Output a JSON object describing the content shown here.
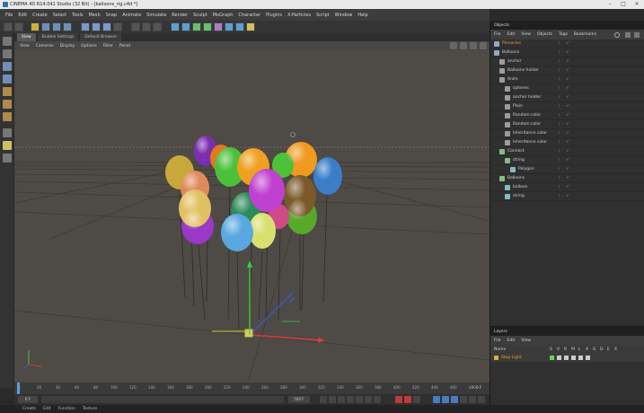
{
  "window": {
    "title": "CINEMA 4D R14.041 Studio (32 Bit) - [balloons_rig.c4d *]",
    "controls": [
      "–",
      "□",
      "×"
    ]
  },
  "menubar": [
    "File",
    "Edit",
    "Create",
    "Select",
    "Tools",
    "Mesh",
    "Snap",
    "Animate",
    "Simulate",
    "Render",
    "Sculpt",
    "MoGraph",
    "Character",
    "Plugins",
    "X-Particles",
    "Script",
    "Window",
    "Help"
  ],
  "viewport": {
    "tabs": [
      "View",
      "Bubble Settings",
      "Default Browser"
    ],
    "active_tab": "View",
    "menu": [
      "View",
      "Cameras",
      "Display",
      "Options",
      "Filter",
      "Panel"
    ]
  },
  "timeline": {
    "ticks": [
      "0",
      "20",
      "40",
      "60",
      "80",
      "100",
      "120",
      "140",
      "160",
      "180",
      "200",
      "220",
      "240",
      "260",
      "280",
      "300",
      "320",
      "340",
      "360",
      "380",
      "400",
      "420",
      "440",
      "460",
      "480"
    ],
    "frame_readout": "0 F"
  },
  "transport": {
    "start_frame": "0 F",
    "end_frame": "500 F"
  },
  "bottombar": [
    "Create",
    "Edit",
    "Function",
    "Texture"
  ],
  "objects_panel": {
    "title": "Objects",
    "menu": [
      "File",
      "Edit",
      "View",
      "Objects",
      "Tags",
      "Bookmarks"
    ],
    "rows": [
      {
        "name": "Pinnacles",
        "depth": 0,
        "selected": true,
        "icon_color": "#8fa8c8"
      },
      {
        "name": "Balloons",
        "depth": 0,
        "selected": false,
        "icon_color": "#8fa8c8"
      },
      {
        "name": "anchor",
        "depth": 1,
        "selected": false,
        "icon_color": "#9c9c9c"
      },
      {
        "name": "Balloons holder",
        "depth": 1,
        "selected": false,
        "icon_color": "#9c9c9c"
      },
      {
        "name": "Anim",
        "depth": 1,
        "selected": false,
        "icon_color": "#9c9c9c"
      },
      {
        "name": "spheres",
        "depth": 2,
        "selected": false,
        "icon_color": "#9c9c9c"
      },
      {
        "name": "anchor holder",
        "depth": 2,
        "selected": false,
        "icon_color": "#9c9c9c"
      },
      {
        "name": "Plain",
        "depth": 2,
        "selected": false,
        "icon_color": "#9c9c9c"
      },
      {
        "name": "Random color",
        "depth": 2,
        "selected": false,
        "icon_color": "#9c9c9c"
      },
      {
        "name": "Random color",
        "depth": 2,
        "selected": false,
        "icon_color": "#9c9c9c"
      },
      {
        "name": "Inheritance color",
        "depth": 2,
        "selected": false,
        "icon_color": "#9c9c9c"
      },
      {
        "name": "Inheritance color",
        "depth": 2,
        "selected": false,
        "icon_color": "#9c9c9c"
      },
      {
        "name": "Connect",
        "depth": 1,
        "selected": false,
        "icon_color": "#7fbf7f"
      },
      {
        "name": "string",
        "depth": 2,
        "selected": false,
        "icon_color": "#7fbf7f"
      },
      {
        "name": "Polygon",
        "depth": 3,
        "selected": false,
        "icon_color": "#7fbfbf"
      },
      {
        "name": "Balloons",
        "depth": 1,
        "selected": false,
        "icon_color": "#7fbf7f"
      },
      {
        "name": "balloon",
        "depth": 2,
        "selected": false,
        "icon_color": "#7fbfbf"
      },
      {
        "name": "string",
        "depth": 2,
        "selected": false,
        "icon_color": "#7fbfbf"
      }
    ]
  },
  "layers_panel": {
    "title": "Layers",
    "menu": [
      "File",
      "Edit",
      "View"
    ],
    "columns": [
      "Name",
      "S",
      "V",
      "R",
      "M",
      "L",
      "A",
      "G",
      "D",
      "E",
      "X"
    ],
    "rows": [
      {
        "name": "Stop Light"
      }
    ]
  },
  "colors": {
    "viewport_bg": "#4e4a45",
    "panel_bg": "#303030",
    "selected_text": "#f0a030",
    "check_green": "#6ad06a"
  }
}
